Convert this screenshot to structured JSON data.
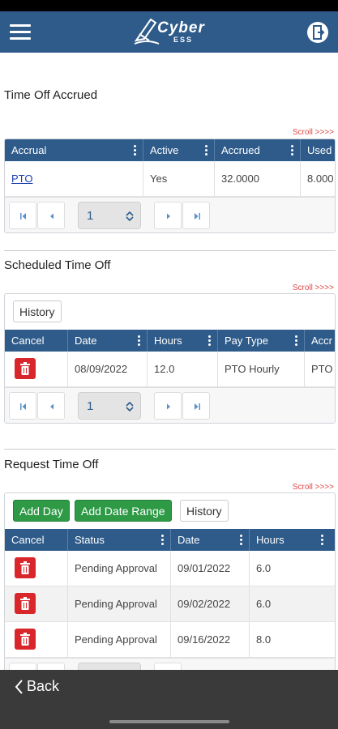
{
  "header": {
    "logo_text": "Cyber",
    "logo_sub": "ESS"
  },
  "colors": {
    "header_bg": "#2e5b8a",
    "accent_green": "#2e9a46",
    "delete_red": "#d9262a",
    "scroll_hint": "#e04848"
  },
  "accrued": {
    "title": "Time Off Accrued",
    "scroll_hint": "Scroll >>>>",
    "columns": [
      "Accrual",
      "Active",
      "Accrued",
      "Used"
    ],
    "rows": [
      {
        "accrual": "PTO",
        "active": "Yes",
        "accrued": "32.0000",
        "used": "8.000"
      }
    ],
    "page": "1"
  },
  "scheduled": {
    "title": "Scheduled Time Off",
    "scroll_hint": "Scroll >>>>",
    "history_label": "History",
    "columns": [
      "Cancel",
      "Date",
      "Hours",
      "Pay Type",
      "Accr"
    ],
    "rows": [
      {
        "date": "08/09/2022",
        "hours": "12.0",
        "pay_type": "PTO Hourly",
        "accrual": "PTO"
      }
    ],
    "page": "1"
  },
  "request": {
    "title": "Request Time Off",
    "scroll_hint": "Scroll >>>>",
    "add_day_label": "Add Day",
    "add_range_label": "Add Date Range",
    "history_label": "History",
    "columns": [
      "Cancel",
      "Status",
      "Date",
      "Hours"
    ],
    "rows": [
      {
        "status": "Pending Approval",
        "date": "09/01/2022",
        "hours": "6.0"
      },
      {
        "status": "Pending Approval",
        "date": "09/02/2022",
        "hours": "6.0"
      },
      {
        "status": "Pending Approval",
        "date": "09/16/2022",
        "hours": "8.0"
      }
    ]
  },
  "footer": {
    "back_label": "Back"
  },
  "icons": {
    "menu": "hamburger-menu-icon",
    "logout": "logout-door-icon",
    "first": "first-page-icon",
    "prev": "prev-page-icon",
    "next": "next-page-icon",
    "last": "last-page-icon",
    "delete": "trash-icon",
    "back": "chevron-left-icon"
  }
}
